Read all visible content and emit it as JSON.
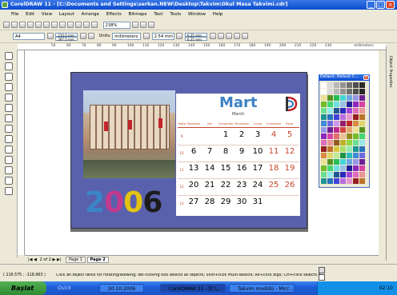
{
  "window": {
    "title": "CorelDRAW 11 - [C:\\Documents and Settings\\serkan.NEW\\Desktop\\Takvim\\Okul Masa Takvimi.cdr]"
  },
  "menu": [
    "File",
    "Edit",
    "View",
    "Layout",
    "Arrange",
    "Effects",
    "Bitmaps",
    "Text",
    "Tools",
    "Window",
    "Help"
  ],
  "toolbar": {
    "zoom": "238%",
    "paper": "A4",
    "width": "210.0 mm",
    "height": "297.0 mm",
    "units_label": "Units:",
    "units": "millimeters",
    "nudge": "2.54 mm",
    "dup_x": "6.35 mm",
    "dup_y": "6.35 mm"
  },
  "ruler": {
    "unit": "millimeters",
    "ticks": [
      "50",
      "60",
      "70",
      "80",
      "90",
      "100",
      "110",
      "120",
      "130",
      "140",
      "150",
      "160",
      "170",
      "180",
      "190",
      "200",
      "210",
      "220",
      "230"
    ]
  },
  "calendar": {
    "month": "Mart",
    "month_en": "March",
    "year": "2006",
    "year_digits": [
      "2",
      "0",
      "0",
      "6"
    ],
    "year_colors": [
      "#3a86c8",
      "#c23a8e",
      "#e3c214",
      "#1c1c1c"
    ],
    "day_headers": [
      "Hafta",
      "Pazartesi",
      "Salı",
      "Çarşamba",
      "Perşembe",
      "Cuma",
      "Cumartesi",
      "Pazar"
    ],
    "rows": [
      {
        "week": "9",
        "days": [
          "",
          "",
          "1",
          "2",
          "3",
          "4",
          "5"
        ]
      },
      {
        "week": "10",
        "days": [
          "6",
          "7",
          "8",
          "9",
          "10",
          "11",
          "12"
        ]
      },
      {
        "week": "11",
        "days": [
          "13",
          "14",
          "15",
          "16",
          "17",
          "18",
          "19"
        ]
      },
      {
        "week": "12",
        "days": [
          "20",
          "21",
          "22",
          "23",
          "24",
          "25",
          "26"
        ]
      },
      {
        "week": "13",
        "days": [
          "27",
          "28",
          "29",
          "30",
          "31",
          "",
          ""
        ]
      }
    ]
  },
  "palette": {
    "title": "Default: Default C..."
  },
  "docker": {
    "label": "Object Properties"
  },
  "page_tabs": {
    "counter": "2 of 2",
    "tab1": "Page 1",
    "tab2": "Page 2"
  },
  "status": {
    "coords": "( 216.575 ; -118.963 )",
    "hint": "Click an object twice for rotating/skewing; dbl-clicking tool selects all objects; Shift+click multi-selects; Alt+click digs; Ctrl+click selects in a group"
  },
  "taskbar": {
    "start": "Başlat",
    "tasks": [
      "Quick Launch",
      "20.10.2006",
      "CorelDRAW 11 - [C:\\...",
      "Takvim modülü - Micr..."
    ],
    "clock": "02:10"
  },
  "colors": {
    "titlebar": "#0a4cd0",
    "page_bg": "#5961ad",
    "accent_red": "#c9442b"
  }
}
